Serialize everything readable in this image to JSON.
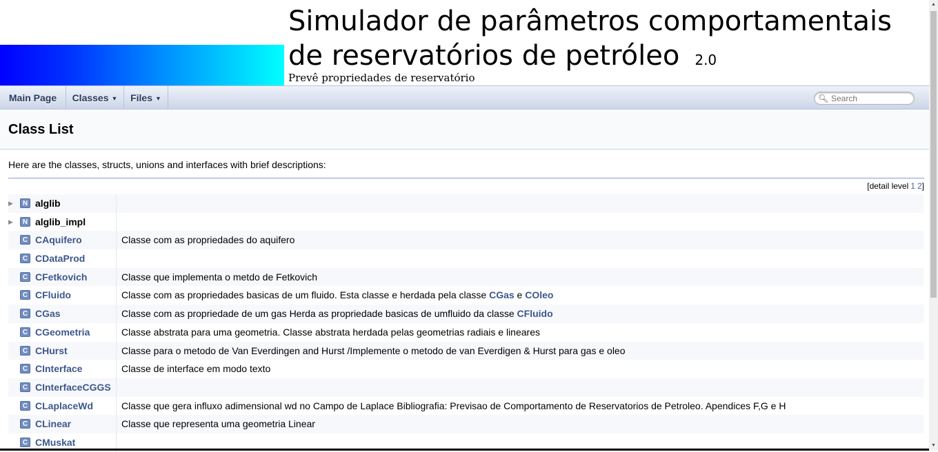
{
  "project": {
    "name": "Simulador de parâmetros comportamentais de reservatórios de petróleo",
    "number": "2.0",
    "brief": "Prevê propriedades de reservatório"
  },
  "nav": {
    "main_page": "Main Page",
    "classes": "Classes",
    "files": "Files",
    "search_placeholder": "Search"
  },
  "page": {
    "title": "Class List",
    "intro": "Here are the classes, structs, unions and interfaces with brief descriptions:",
    "detail_level_label": "[detail level",
    "detail_levels": [
      "1",
      "2"
    ],
    "detail_level_close": "]"
  },
  "colors": {
    "link": "#3d578c",
    "badge": "#728dc1",
    "nav_text": "#283a5d"
  },
  "rows": [
    {
      "kind": "N",
      "name": "alglib",
      "expandable": true,
      "desc": ""
    },
    {
      "kind": "N",
      "name": "alglib_impl",
      "expandable": true,
      "desc": ""
    },
    {
      "kind": "C",
      "name": "CAquifero",
      "desc": "Classe com as propriedades do aquifero"
    },
    {
      "kind": "C",
      "name": "CDataProd",
      "desc": ""
    },
    {
      "kind": "C",
      "name": "CFetkovich",
      "desc": "Classe que implementa o metdo de Fetkovich"
    },
    {
      "kind": "C",
      "name": "CFluido",
      "desc": "Classe com as propriedades basicas de um fluido. Esta classe e herdada pela classe ",
      "links": [
        "CGas",
        " e ",
        "COleo"
      ]
    },
    {
      "kind": "C",
      "name": "CGas",
      "desc": "Classe com as propriedade de um gas Herda as propriedade basicas de umfluido da classe ",
      "links": [
        "CFluido"
      ]
    },
    {
      "kind": "C",
      "name": "CGeometria",
      "desc": "Classe abstrata para uma geometria. Classe abstrata herdada pelas geometrias radiais e lineares"
    },
    {
      "kind": "C",
      "name": "CHurst",
      "desc": "Classe para o metodo de Van Everdingen and Hurst /Implemente o metodo de van Everdigen & Hurst para gas e oleo"
    },
    {
      "kind": "C",
      "name": "CInterface",
      "desc": "Classe de interface em modo texto"
    },
    {
      "kind": "C",
      "name": "CInterfaceCGGS",
      "desc": ""
    },
    {
      "kind": "C",
      "name": "CLaplaceWd",
      "desc": "Classe que gera influxo adimensional wd no Campo de Laplace Bibliografia: Previsao de Comportamento de Reservatorios de Petroleo. Apendices F,G e H"
    },
    {
      "kind": "C",
      "name": "CLinear",
      "desc": "Classe que representa uma geometria Linear"
    },
    {
      "kind": "C",
      "name": "CMuskat",
      "desc": ""
    }
  ]
}
